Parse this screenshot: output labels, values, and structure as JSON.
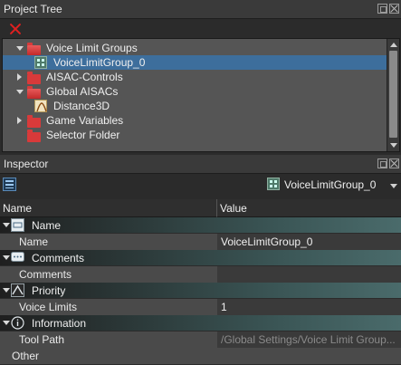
{
  "project_tree": {
    "title": "Project Tree",
    "items": [
      {
        "label": "Voice Limit Groups",
        "icon": "folder-open-icon",
        "expanded": true
      },
      {
        "label": "VoiceLimitGroup_0",
        "icon": "voice-limit-group-icon",
        "selected": true
      },
      {
        "label": "AISAC-Controls",
        "icon": "folder-icon",
        "expanded": false
      },
      {
        "label": "Global AISACs",
        "icon": "folder-open-icon",
        "expanded": true
      },
      {
        "label": "Distance3D",
        "icon": "aisac-curve-icon"
      },
      {
        "label": "Game Variables",
        "icon": "folder-icon",
        "expanded": false
      },
      {
        "label": "Selector Folder",
        "icon": "folder-icon"
      }
    ]
  },
  "inspector": {
    "title": "Inspector",
    "target_label": "VoiceLimitGroup_0",
    "columns": {
      "name": "Name",
      "value": "Value"
    },
    "categories": [
      {
        "label": "Name",
        "icon": "name-tag-icon"
      },
      {
        "label": "Comments",
        "icon": "comment-icon"
      },
      {
        "label": "Priority",
        "icon": "priority-icon"
      },
      {
        "label": "Information",
        "icon": "info-icon"
      }
    ],
    "properties": {
      "name": {
        "label": "Name",
        "value": "VoiceLimitGroup_0"
      },
      "comments": {
        "label": "Comments",
        "value": ""
      },
      "voice_limits": {
        "label": "Voice Limits",
        "value": "1"
      },
      "tool_path": {
        "label": "Tool Path",
        "value": "/Global Settings/Voice Limit Group..."
      },
      "other": {
        "label": "Other"
      }
    }
  }
}
